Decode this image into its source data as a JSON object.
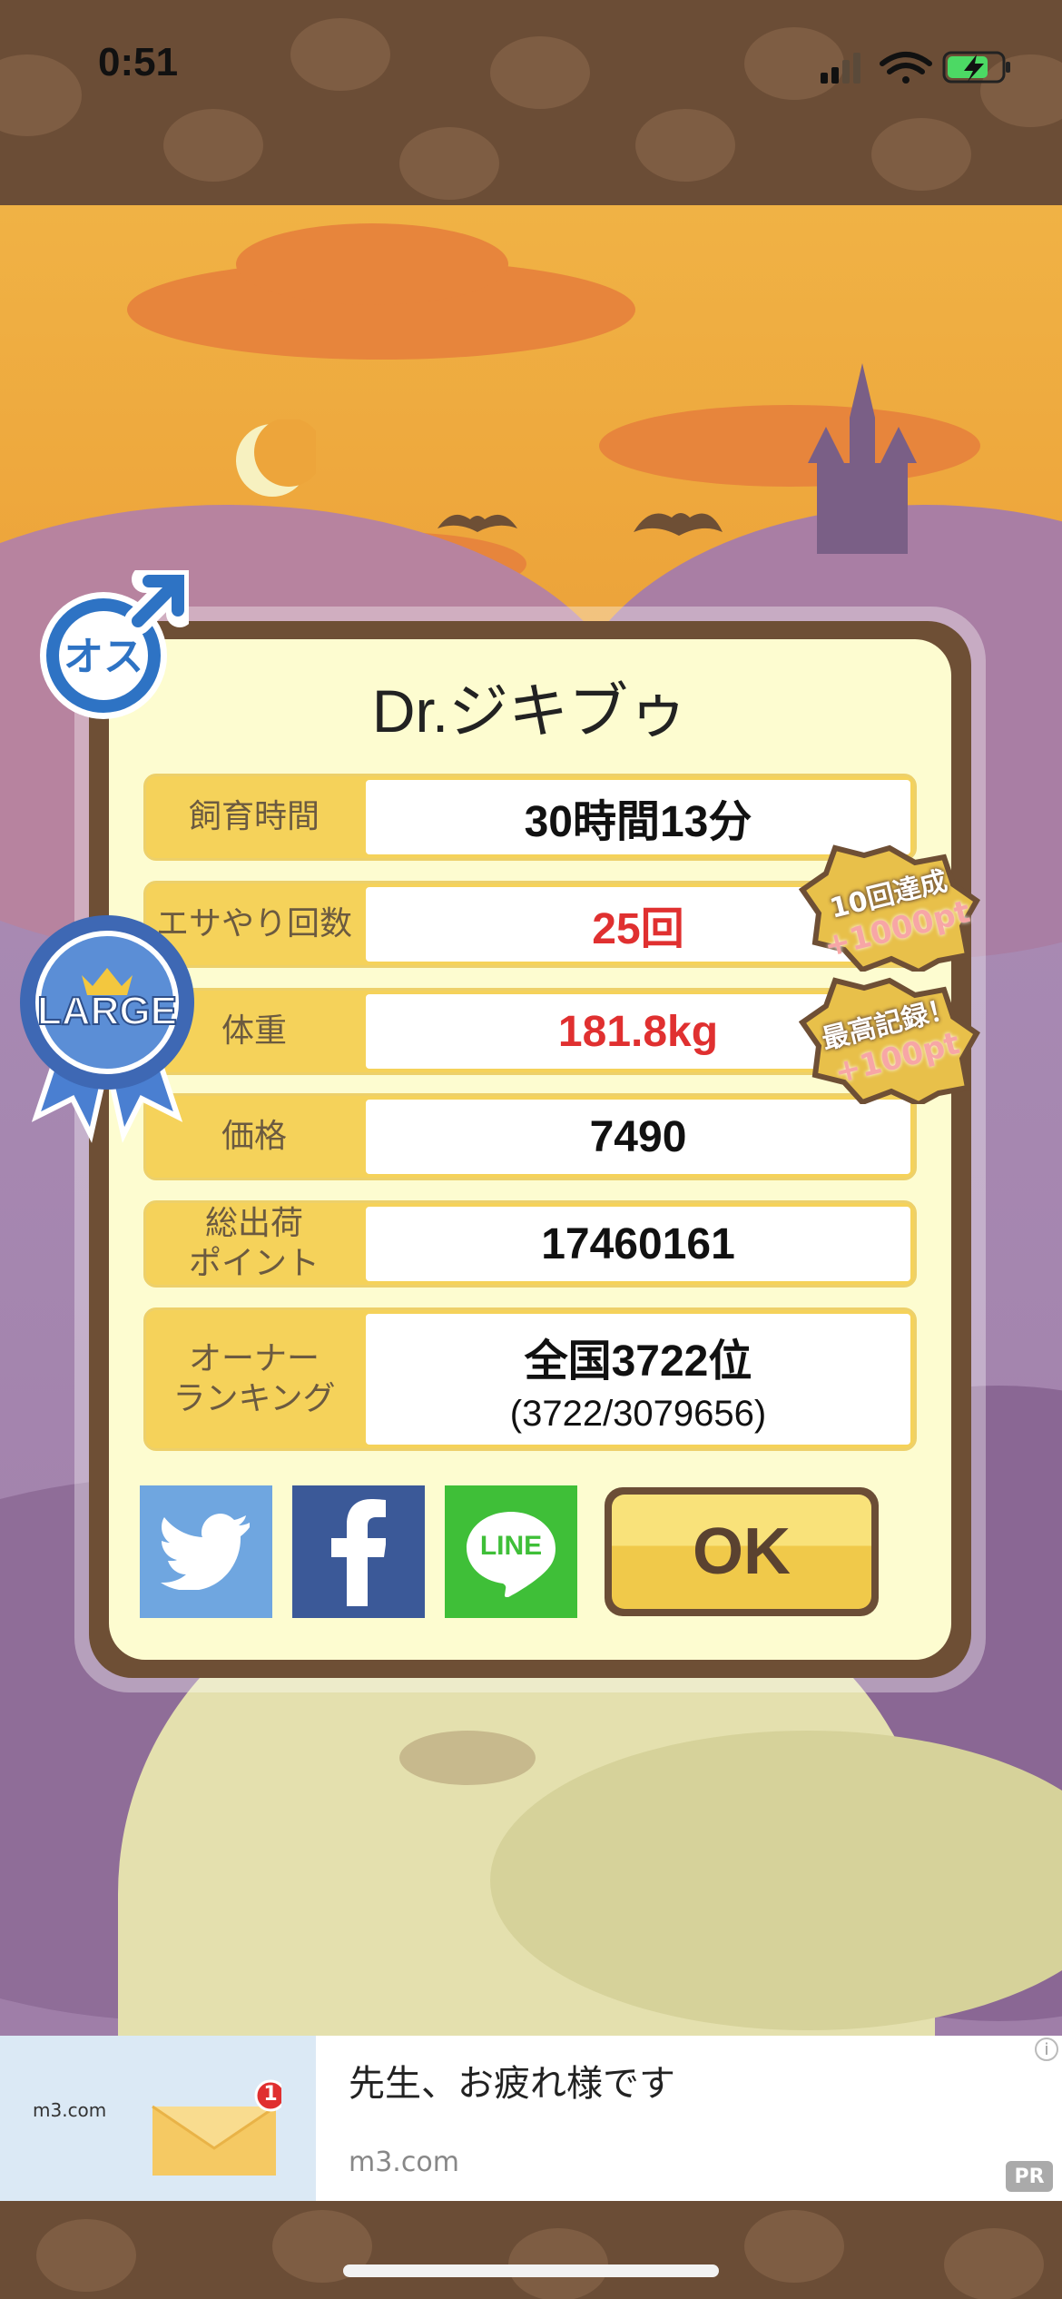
{
  "status_bar": {
    "time": "0:51"
  },
  "pet": {
    "name": "Dr.ジキブゥ",
    "gender_badge": "オス",
    "size_badge": "LARGE"
  },
  "stats": [
    {
      "label": "飼育時間",
      "value": "30時間13分",
      "highlight": false
    },
    {
      "label": "エサやり回数",
      "value": "25回",
      "highlight": true
    },
    {
      "label": "体重",
      "value": "181.8kg",
      "highlight": true
    },
    {
      "label": "価格",
      "value": "7490",
      "highlight": false
    },
    {
      "label": "総出荷\nポイント",
      "value": "17460161",
      "highlight": false
    },
    {
      "label": "オーナー\nランキング",
      "value": "全国3722位",
      "sub": "(3722/3079656)",
      "highlight": false
    }
  ],
  "achievements": [
    {
      "title": "10回達成",
      "bonus": "+1000pt"
    },
    {
      "title": "最高記録！",
      "bonus": "+100pt"
    }
  ],
  "share": {
    "twitter_icon": "twitter-bird-icon",
    "facebook_icon": "facebook-f-icon",
    "line_label": "LINE"
  },
  "ok_label": "OK",
  "ad": {
    "brand": "m3.com",
    "title": "先生、お疲れ様です",
    "domain": "m3.com",
    "pr": "PR",
    "info": "i",
    "notification_count": "1"
  },
  "colors": {
    "accent_red": "#e03030",
    "label_bg": "#f5d25a",
    "frame": "#6e4f35",
    "twitter": "#6fa6e0",
    "facebook": "#3b5998",
    "line": "#3fbf38"
  }
}
